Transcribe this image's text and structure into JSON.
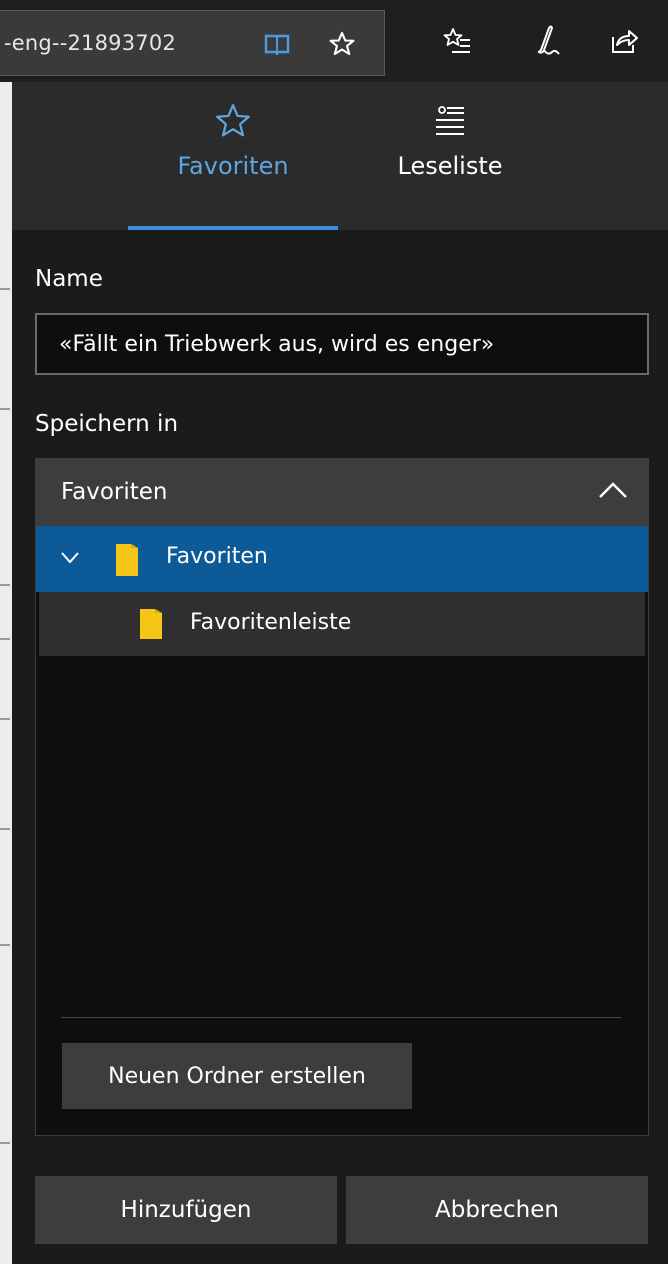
{
  "toolbar": {
    "address_text": "-eng--21893702",
    "icons": [
      "reading-view-icon",
      "favorite-star-icon",
      "favorites-hub-icon",
      "web-note-icon",
      "share-icon"
    ]
  },
  "tabs": [
    {
      "label": "Favoriten",
      "icon": "star-outline-icon",
      "active": true
    },
    {
      "label": "Leseliste",
      "icon": "reading-list-icon",
      "active": false
    }
  ],
  "form": {
    "name_label": "Name",
    "name_value": "«Fällt ein Triebwerk aus, wird es enger»",
    "save_in_label": "Speichern in",
    "selected_folder": "Favoriten",
    "tree": [
      {
        "label": "Favoriten",
        "level": 0,
        "expanded": true,
        "selected": true
      },
      {
        "label": "Favoritenleiste",
        "level": 1,
        "expanded": false,
        "selected": false
      }
    ],
    "new_folder_label": "Neuen Ordner erstellen"
  },
  "actions": {
    "add_label": "Hinzufügen",
    "cancel_label": "Abbrechen"
  },
  "colors": {
    "accent": "#3b8fd8",
    "selection": "#0d5a98",
    "folder": "#f5c518"
  }
}
